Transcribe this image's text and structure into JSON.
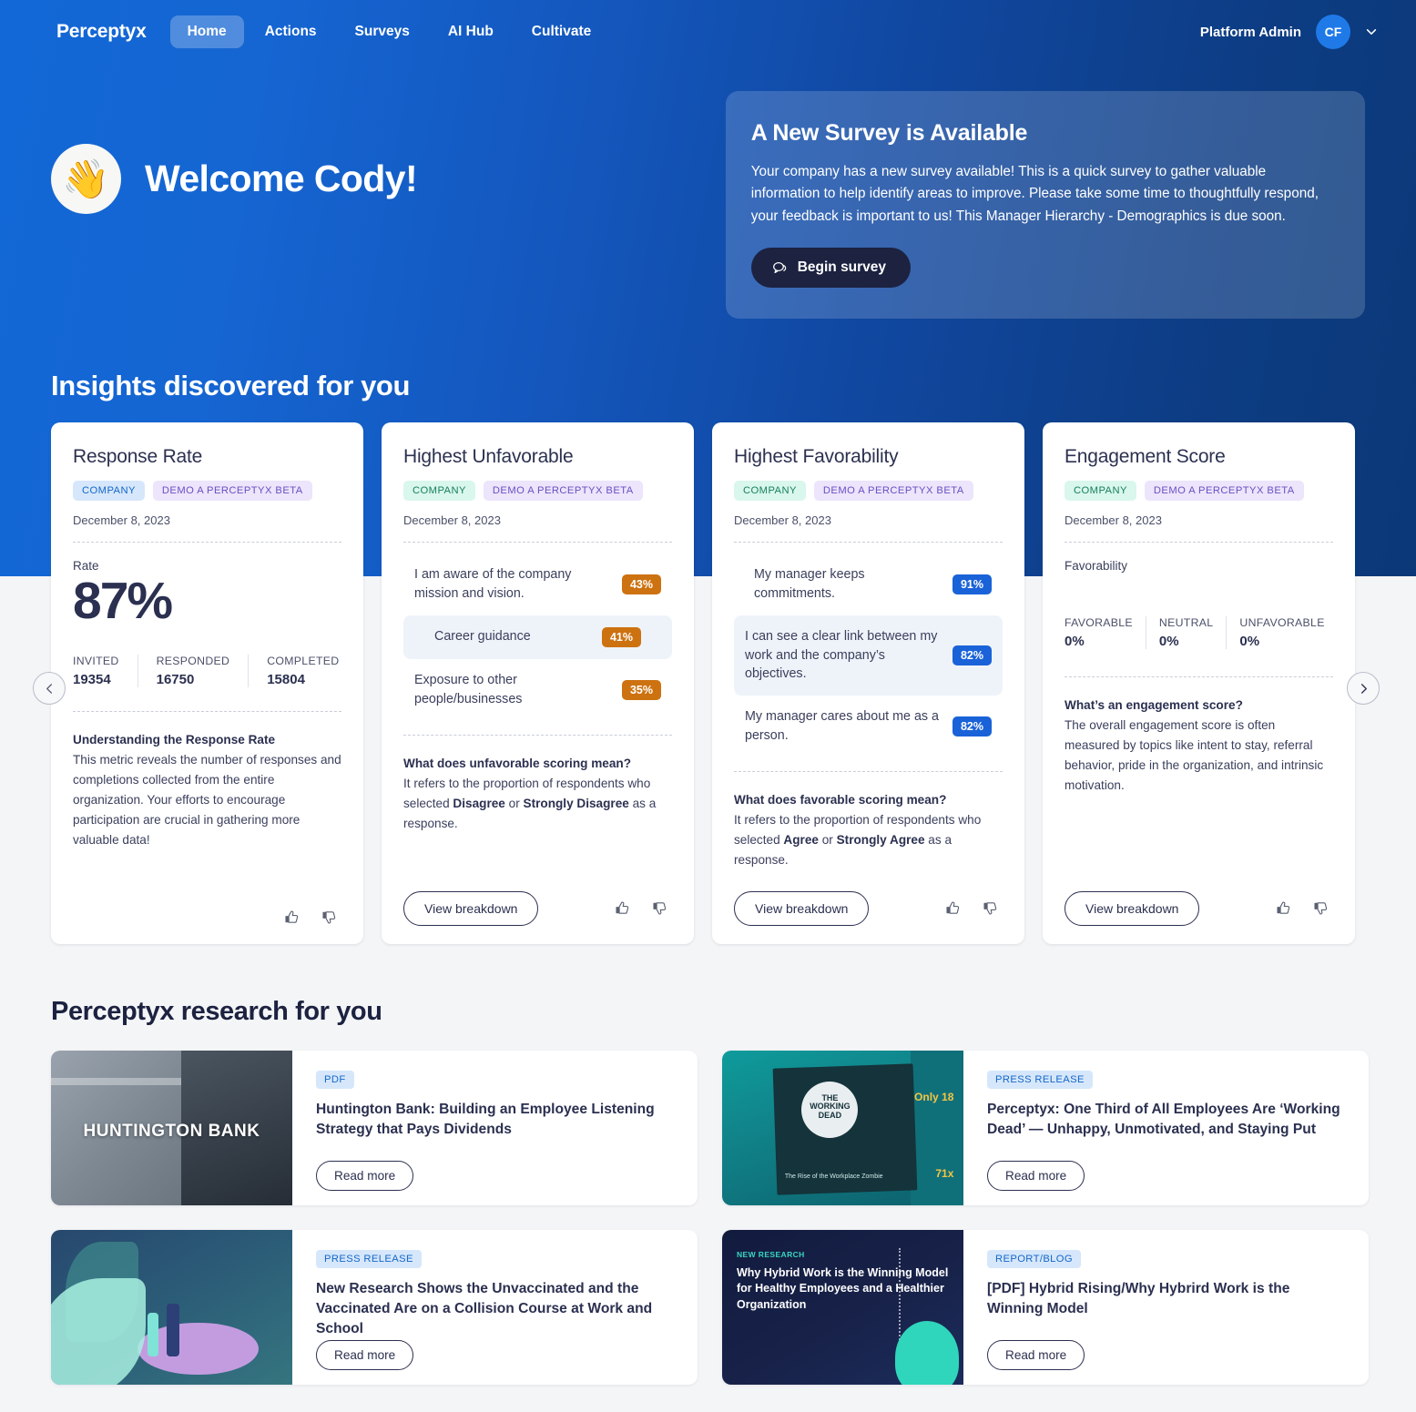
{
  "nav": {
    "brand": "Perceptyx",
    "links": [
      {
        "label": "Home",
        "active": true
      },
      {
        "label": "Actions",
        "active": false
      },
      {
        "label": "Surveys",
        "active": false
      },
      {
        "label": "AI Hub",
        "active": false
      },
      {
        "label": "Cultivate",
        "active": false
      }
    ],
    "admin_label": "Platform Admin",
    "avatar_initials": "CF"
  },
  "hero": {
    "wave_emoji": "👋",
    "welcome_title": "Welcome Cody!",
    "survey": {
      "title": "A New Survey is Available",
      "body": "Your company has a new survey available! This is a quick survey to gather valuable information to help identify areas to improve. Please take some time to thoughtfully respond, your feedback is important to us! This Manager Hierarchy - Demographics is due soon.",
      "button_label": "Begin survey"
    }
  },
  "insights": {
    "heading": "Insights discovered for you",
    "prev_label": "Previous",
    "next_label": "Next",
    "cards": [
      {
        "title": "Response Rate",
        "tag_company": "COMPANY",
        "tag_demo": "DEMO A PERCEPTYX BETA",
        "date": "December 8, 2023",
        "rate_label": "Rate",
        "rate_value": "87%",
        "stats": [
          {
            "label": "INVITED",
            "value": "19354"
          },
          {
            "label": "RESPONDED",
            "value": "16750"
          },
          {
            "label": "COMPLETED",
            "value": "15804"
          }
        ],
        "expl_head": "Understanding the Response Rate",
        "expl_body": "This metric reveals the number of responses and completions collected from the entire organization. Your efforts to encourage participation are crucial in gathering more valuable data!"
      },
      {
        "title": "Highest Unfavorable",
        "tag_company": "COMPANY",
        "tag_demo": "DEMO A PERCEPTYX BETA",
        "date": "December 8, 2023",
        "rows": [
          {
            "text": "I am aware of the company mission and vision.",
            "pct": "43%",
            "highlight": false
          },
          {
            "text": "Career guidance",
            "pct": "41%",
            "highlight": true
          },
          {
            "text": "Exposure to other people/businesses",
            "pct": "35%",
            "highlight": false
          }
        ],
        "expl_head": "What does unfavorable scoring mean?",
        "expl_body_1": "It refers to the proportion of respondents who selected ",
        "expl_bold_1": "Disagree",
        "expl_body_2": " or ",
        "expl_bold_2": "Strongly Disagree",
        "expl_body_3": " as a response.",
        "button_label": "View breakdown"
      },
      {
        "title": "Highest Favorability",
        "tag_company": "COMPANY",
        "tag_demo": "DEMO A PERCEPTYX BETA",
        "date": "December 8, 2023",
        "rows": [
          {
            "text": "My manager keeps commitments.",
            "pct": "91%",
            "highlight": false
          },
          {
            "text": "I can see a clear link between my work and the company’s objectives.",
            "pct": "82%",
            "highlight": true
          },
          {
            "text": "My manager cares about me as a person.",
            "pct": "82%",
            "highlight": false
          }
        ],
        "expl_head": "What does favorable scoring mean?",
        "expl_body_1": "It refers to the proportion of respondents who selected ",
        "expl_bold_1": "Agree",
        "expl_body_2": " or ",
        "expl_bold_2": "Strongly Agree",
        "expl_body_3": " as a response.",
        "button_label": "View breakdown"
      },
      {
        "title": "Engagement Score",
        "tag_company": "COMPANY",
        "tag_demo": "DEMO A PERCEPTYX BETA",
        "date": "December 8, 2023",
        "fav_label": "Favorability",
        "stats": [
          {
            "label": "FAVORABLE",
            "value": "0%"
          },
          {
            "label": "NEUTRAL",
            "value": "0%"
          },
          {
            "label": "UNFAVORABLE",
            "value": "0%"
          }
        ],
        "expl_head": "What’s an engagement score?",
        "expl_body": "The overall engagement score is often measured by topics like intent to stay, referral behavior, pride in the organization, and intrinsic motivation.",
        "button_label": "View breakdown"
      }
    ]
  },
  "research": {
    "heading": "Perceptyx research for you",
    "items": [
      {
        "tag": "PDF",
        "title": "Huntington Bank: Building an Employee Listening Strategy that Pays Dividends",
        "button_label": "Read more",
        "thumb_text": "HUNTINGTON BANK"
      },
      {
        "tag": "PRESS RELEASE",
        "title": "Perceptyx: One Third of All Employees Are ‘Working Dead’ — Unhappy, Unmotivated, and Staying Put",
        "button_label": "Read more",
        "thumb_text": "THE WORKING DEAD",
        "thumb_caption": "The Rise of the Workplace Zombie",
        "thumb_num_1": "Only 18",
        "thumb_num_2": "71x"
      },
      {
        "tag": "PRESS RELEASE",
        "title": "New Research Shows the Unvaccinated and the Vaccinated Are on a Collision Course at Work and School",
        "button_label": "Read more"
      },
      {
        "tag": "REPORT/BLOG",
        "title": "[PDF] Hybrid Rising/Why Hybrird Work is the Winning Model",
        "button_label": "Read more",
        "thumb_label": "NEW RESEARCH",
        "thumb_title": "Why Hybrid Work is the Winning Model for Healthy Employees and a Healthier Organization"
      }
    ]
  }
}
